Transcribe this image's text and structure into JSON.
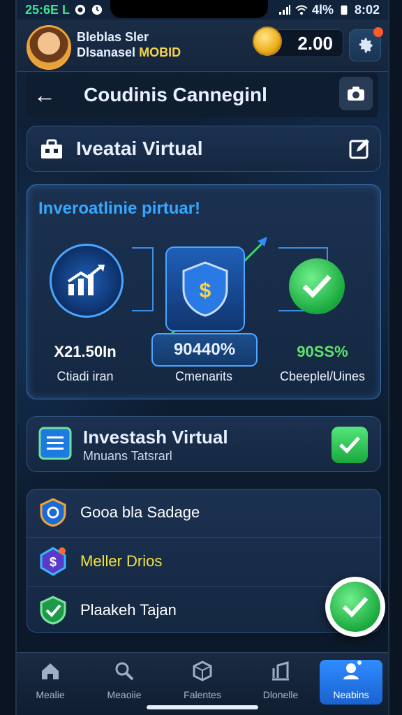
{
  "status_bar": {
    "left_text": "25:6E L",
    "right_time": "8:02",
    "battery_text": "4l%"
  },
  "header": {
    "profile_line1": "Bleblas Sler",
    "profile_line2_prefix": "Dlsanasel",
    "profile_line2_accent": "MOBID",
    "balance": "2.00"
  },
  "titlebar": {
    "title": "Coudinis Canneginl"
  },
  "section": {
    "label": "Iveatai Virtual"
  },
  "panel": {
    "heading": "Inveroatlinie pirtuar!",
    "stats": [
      {
        "value": "X21.50In",
        "label": "Ctiadi iran",
        "value_color": "#ffffff"
      },
      {
        "value": "90440%",
        "label": "Cmenarits",
        "value_color": "#ffffff"
      },
      {
        "value": "90SS%",
        "label": "Cbeeplel/Uines",
        "value_color": "#5fe36b"
      }
    ]
  },
  "invest": {
    "title": "Investash Virtual",
    "subtitle": "Mnuans Tatsrarl"
  },
  "list": [
    {
      "label": "Gooa bla Sadage",
      "color": "#ffffff",
      "icon": "shield-badge-icon"
    },
    {
      "label": "Meller Drios",
      "color": "#f3e33d",
      "icon": "dollar-badge-icon"
    },
    {
      "label": "Plaakeh Tajan",
      "color": "#ffffff",
      "icon": "check-shield-icon"
    }
  ],
  "bottom_nav": [
    {
      "label": "Mealie",
      "icon": "home-icon",
      "active": false
    },
    {
      "label": "Meaoiie",
      "icon": "search-icon",
      "active": false
    },
    {
      "label": "Falentes",
      "icon": "cube-icon",
      "active": false
    },
    {
      "label": "Dlonelle",
      "icon": "chart-icon",
      "active": false
    },
    {
      "label": "Neabins",
      "icon": "profile-badge-icon",
      "active": true
    }
  ]
}
